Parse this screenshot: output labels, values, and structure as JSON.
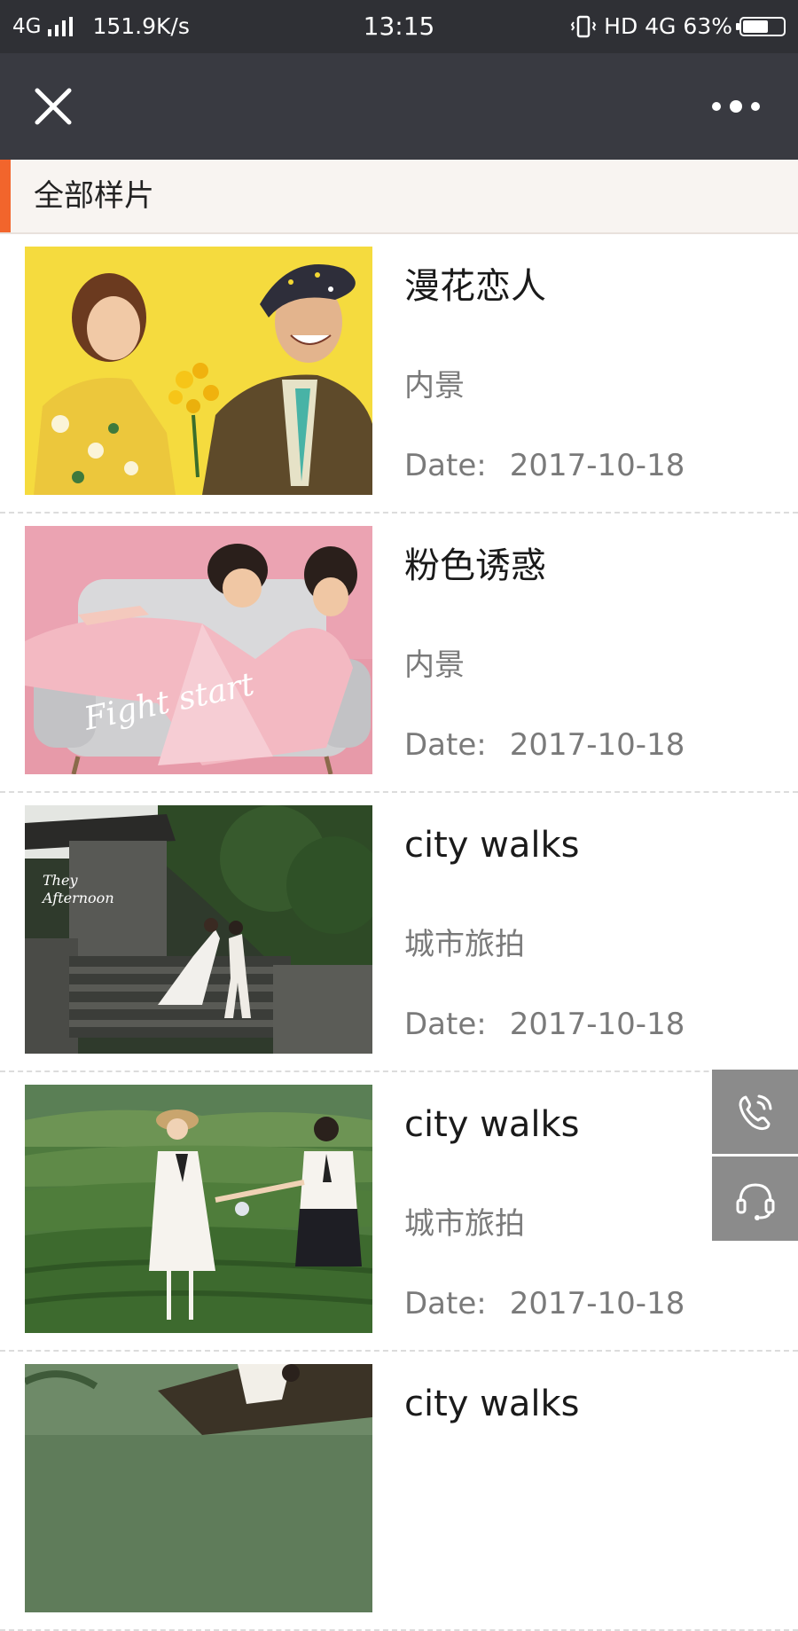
{
  "status_bar": {
    "network": "4G",
    "speed": "151.9K/s",
    "time": "13:15",
    "right": "HD 4G",
    "battery": "63%",
    "battery_level": 0.63
  },
  "nav": {
    "close_icon": "close-icon",
    "more_icon": "more-dots-icon"
  },
  "section": {
    "title": "全部样片",
    "accent_color": "#f2652c"
  },
  "date_label": "Date:",
  "items": [
    {
      "title": "漫花恋人",
      "category": "内景",
      "date": "2017-10-18",
      "photo": "couple on yellow background with flowers"
    },
    {
      "title": "粉色诱惑",
      "category": "内景",
      "date": "2017-10-18",
      "photo": "couple on grey armchair, pink background, text \"Fight start\""
    },
    {
      "title": "city walks",
      "category": "城市旅拍",
      "date": "2017-10-18",
      "photo": "couple on stone stairs, text \"They Afternoon\""
    },
    {
      "title": "city walks",
      "category": "城市旅拍",
      "date": "2017-10-18",
      "photo": "couple in tea field"
    },
    {
      "title": "city walks",
      "category": "",
      "date": "",
      "photo": "couple by water (partially visible)"
    }
  ],
  "floating": {
    "call_icon": "phone-call-icon",
    "service_icon": "headset-icon",
    "color": "#8b8b8b"
  }
}
